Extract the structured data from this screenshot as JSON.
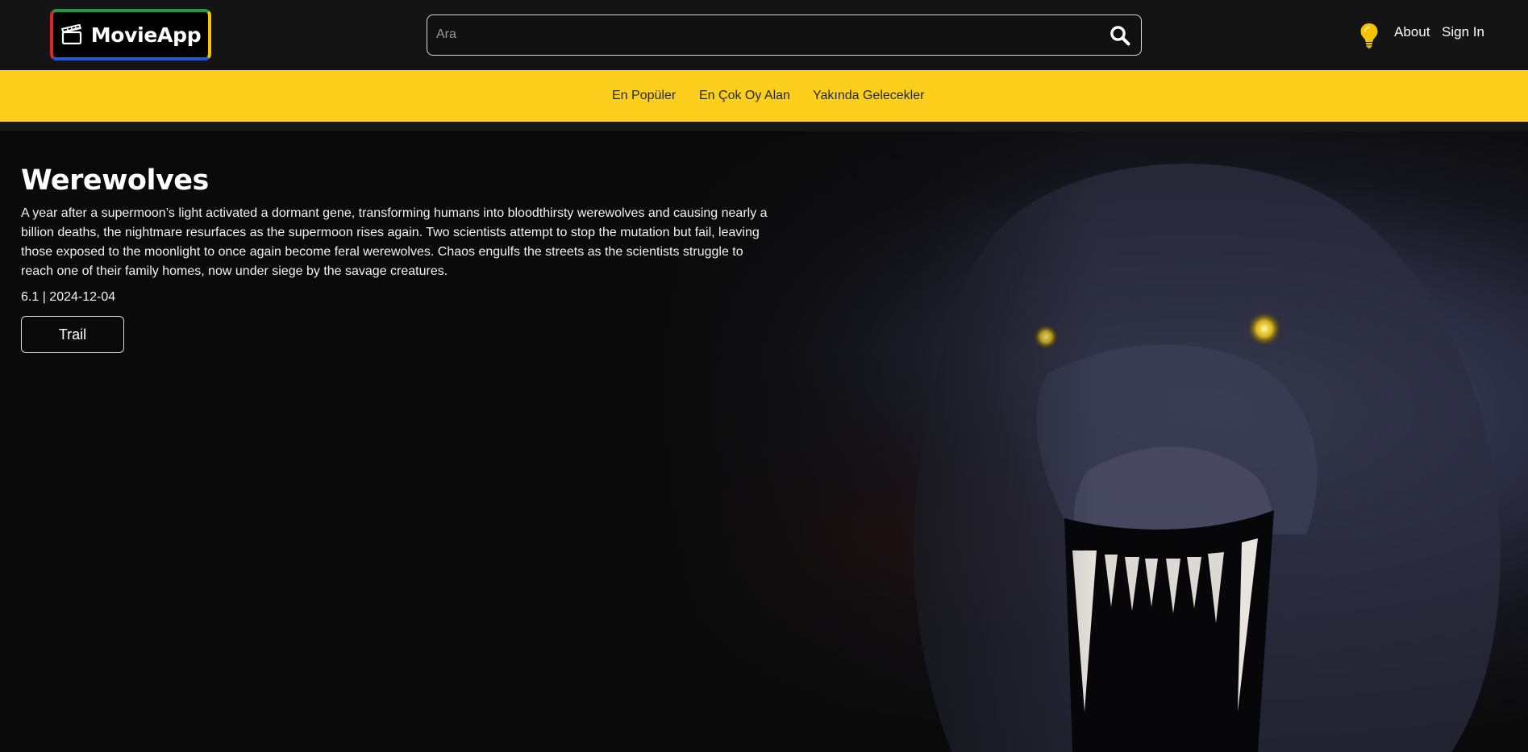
{
  "header": {
    "logo_text": "MovieApp",
    "search": {
      "placeholder": "Ara",
      "value": ""
    },
    "nav": {
      "about": "About",
      "sign_in": "Sign In"
    }
  },
  "categories": [
    "En Popüler",
    "En Çok Oy Alan",
    "Yakında Gelecekler"
  ],
  "hero": {
    "title": "Werewolves",
    "overview": "A year after a supermoon’s light activated a dormant gene, transforming humans into bloodthirsty werewolves and causing nearly a billion deaths, the nightmare resurfaces as the supermoon rises again. Two scientists attempt to stop the mutation but fail, leaving those exposed to the moonlight to once again become feral werewolves. Chaos engulfs the streets as the scientists struggle to reach one of their family homes, now under siege by the savage creatures.",
    "meta": "6.1 | 2024-12-04",
    "trail_button": "Trail"
  },
  "colors": {
    "header_bg": "#141414",
    "category_bar": "#fbcf1b",
    "bulb": "#f5c400",
    "logo_border_top": "#1a9c46",
    "logo_border_left": "#d42a2a",
    "logo_border_bottom": "#2459d6",
    "logo_border_right": "#f5c400"
  },
  "icons": {
    "logo": "clapperboard-icon",
    "search": "search-icon",
    "theme": "lightbulb-icon"
  }
}
